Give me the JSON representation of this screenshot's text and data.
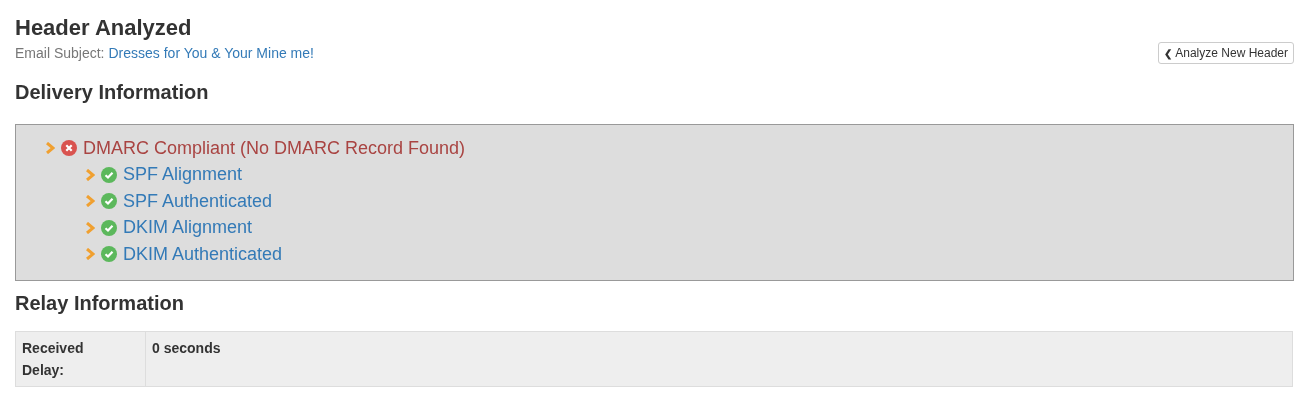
{
  "title": "Header Analyzed",
  "subject": {
    "label": "Email Subject:",
    "value": "Dresses for You & Your Mine me!"
  },
  "back_button": {
    "icon": "❮",
    "label": "Analyze New Header"
  },
  "delivery": {
    "heading": "Delivery Information",
    "items": [
      {
        "label": "DMARC Compliant (No DMARC Record Found)",
        "kind": "fail",
        "children": [
          {
            "label": "SPF Alignment",
            "kind": "pass"
          },
          {
            "label": "SPF Authenticated",
            "kind": "pass"
          },
          {
            "label": "DKIM Alignment",
            "kind": "pass"
          },
          {
            "label": "DKIM Authenticated",
            "kind": "pass"
          }
        ]
      }
    ]
  },
  "relay": {
    "heading": "Relay Information",
    "rows": [
      {
        "label": "Received Delay:",
        "value": "0 seconds"
      }
    ]
  }
}
